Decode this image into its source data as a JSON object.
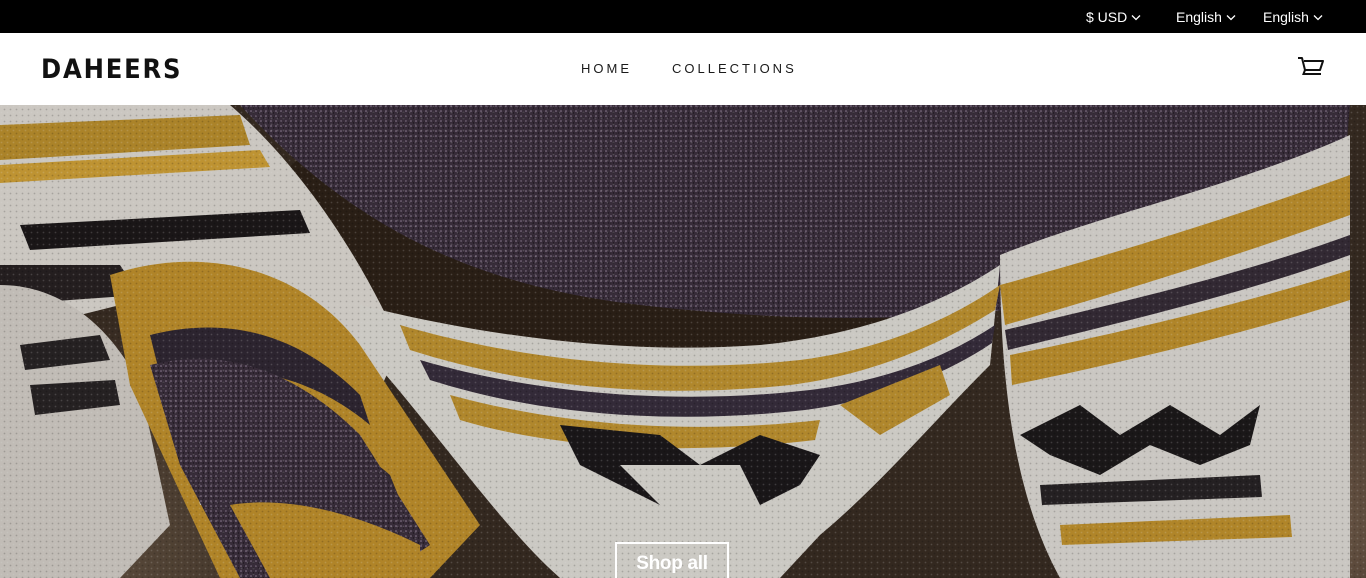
{
  "topbar": {
    "currency": "$ USD",
    "language_primary": "English",
    "language_secondary": "English"
  },
  "header": {
    "logo": "DAHEERS",
    "nav": [
      {
        "label": "HOME"
      },
      {
        "label": "COLLECTIONS"
      }
    ],
    "cart_icon": "cart-icon"
  },
  "hero": {
    "image": "woven-striped-blanket-photo",
    "cta_label": "Shop all"
  },
  "colors": {
    "topbar_bg": "#000000",
    "header_bg": "#ffffff",
    "text_dark": "#111111",
    "cta_border": "#ffffff"
  }
}
